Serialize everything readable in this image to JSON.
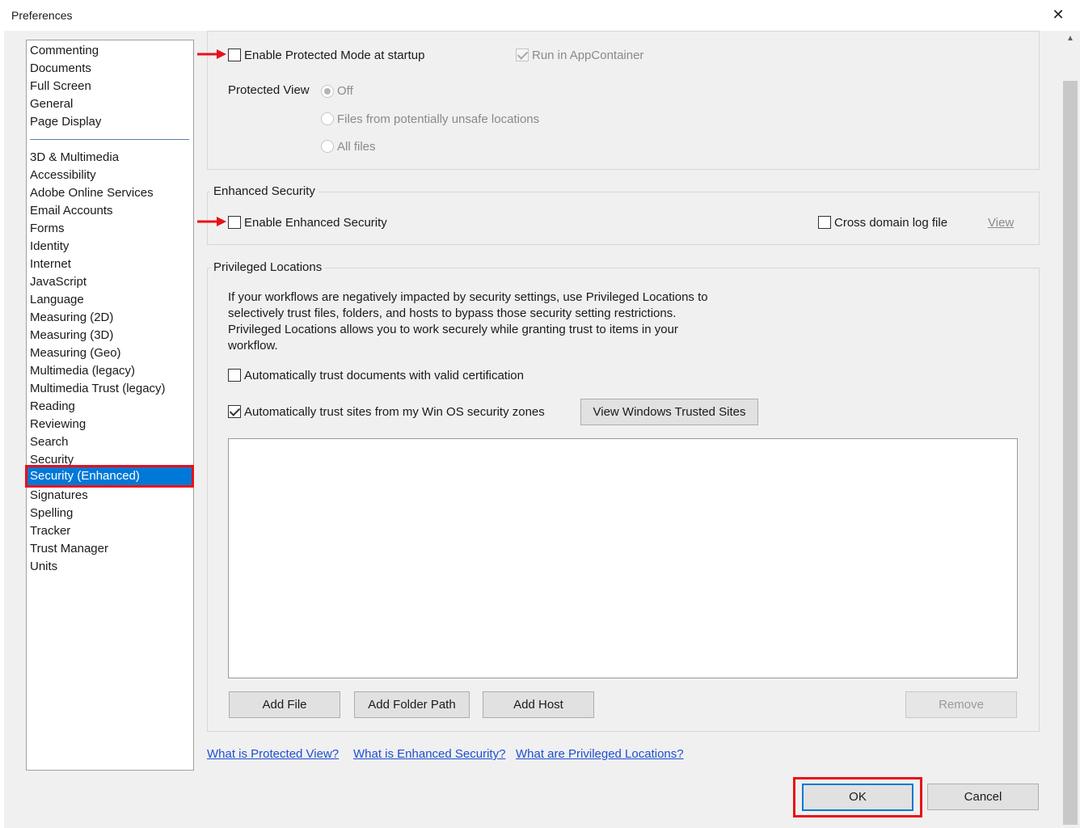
{
  "window": {
    "title": "Preferences",
    "close_glyph": "✕"
  },
  "categories": {
    "group1": [
      "Commenting",
      "Documents",
      "Full Screen",
      "General",
      "Page Display"
    ],
    "group2": [
      "3D & Multimedia",
      "Accessibility",
      "Adobe Online Services",
      "Email Accounts",
      "Forms",
      "Identity",
      "Internet",
      "JavaScript",
      "Language",
      "Measuring (2D)",
      "Measuring (3D)",
      "Measuring (Geo)",
      "Multimedia (legacy)",
      "Multimedia Trust (legacy)",
      "Reading",
      "Reviewing",
      "Search",
      "Security"
    ],
    "selected": "Security (Enhanced)",
    "group3": [
      "Signatures",
      "Spelling",
      "Tracker",
      "Trust Manager",
      "Units"
    ]
  },
  "sandbox": {
    "protected_mode": {
      "label": "Enable Protected Mode at startup",
      "checked": false
    },
    "run_appcontainer": {
      "label": "Run in AppContainer",
      "checked": true,
      "disabled": true
    },
    "protected_view": {
      "label": "Protected View",
      "options": [
        "Off",
        "Files from potentially unsafe locations",
        "All files"
      ],
      "selected": "Off"
    }
  },
  "enhanced_security": {
    "legend": "Enhanced Security",
    "enable": {
      "label": "Enable Enhanced Security",
      "checked": false
    },
    "cross_domain": {
      "label": "Cross domain log file",
      "checked": false
    },
    "view_link": "View"
  },
  "privileged_locations": {
    "legend": "Privileged Locations",
    "description": "If your workflows are negatively impacted by security settings, use Privileged Locations to selectively trust files, folders, and hosts to bypass those security setting restrictions. Privileged Locations allows you to work securely while granting trust to items in your workflow.",
    "trust_certified": {
      "label": "Automatically trust documents with valid certification",
      "checked": false
    },
    "trust_sites": {
      "label": "Automatically trust sites from my Win OS security zones",
      "checked": true
    },
    "view_trusted_sites_button": "View Windows Trusted Sites",
    "buttons": {
      "add_file": "Add File",
      "add_folder": "Add Folder Path",
      "add_host": "Add Host",
      "remove": "Remove"
    }
  },
  "help_links": {
    "protected_view": "What is Protected View?",
    "enhanced_security": "What is Enhanced Security?",
    "privileged_locations": "What are Privileged Locations?"
  },
  "footer": {
    "ok": "OK",
    "cancel": "Cancel"
  },
  "colors": {
    "annotation_red": "#e8101a",
    "selection_blue": "#0078d7",
    "link_blue": "#1f4fd0"
  }
}
